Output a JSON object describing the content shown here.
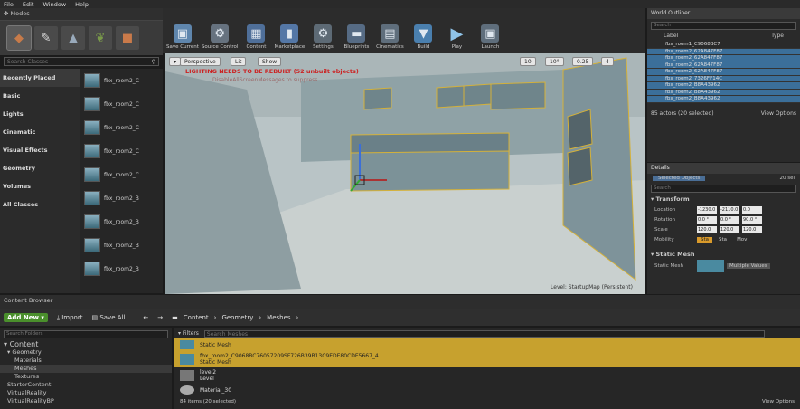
{
  "menu": [
    "File",
    "Edit",
    "Window",
    "Help"
  ],
  "modes": {
    "tab": "Modes",
    "search_placeholder": "Search Classes"
  },
  "categories": [
    "Recently Placed",
    "Basic",
    "Lights",
    "Cinematic",
    "Visual Effects",
    "Geometry",
    "Volumes",
    "All Classes"
  ],
  "placed_items": [
    "fbx_room2_C",
    "fbx_room2_C",
    "fbx_room2_C",
    "fbx_room2_C",
    "fbx_room2_C",
    "fbx_room2_B",
    "fbx_room2_B",
    "fbx_room2_B",
    "fbx_room2_B"
  ],
  "toolbar": [
    {
      "label": "Save Current",
      "icon": "save-icon",
      "color": "#6a8fb5"
    },
    {
      "label": "Source Control",
      "icon": "source-control-icon",
      "color": "#6d7c8a"
    },
    {
      "label": "Content",
      "icon": "content-icon",
      "color": "#5877a0"
    },
    {
      "label": "Marketplace",
      "icon": "marketplace-icon",
      "color": "#5b7fb0"
    },
    {
      "label": "Settings",
      "icon": "gear-icon",
      "color": "#6b7a86"
    },
    {
      "label": "Blueprints",
      "icon": "blueprint-icon",
      "color": "#5d7592"
    },
    {
      "label": "Cinematics",
      "icon": "clapper-icon",
      "color": "#6a7a8a"
    },
    {
      "label": "Build",
      "icon": "build-icon",
      "color": "#4f86b8"
    },
    {
      "label": "Play",
      "icon": "play-icon",
      "color": "#4f86b8"
    },
    {
      "label": "Launch",
      "icon": "launch-icon",
      "color": "#6a7a8a"
    }
  ],
  "viewport": {
    "perspective": "Perspective",
    "lit": "Lit",
    "show": "Show",
    "warning": "LIGHTING NEEDS TO BE REBUILT (52 unbuilt objects)",
    "warning_sub": "DisableAllScreenMessages to suppress",
    "level": "Level:",
    "level_name": "StartupMap (Persistent)",
    "snap": [
      "10",
      "10°",
      "0.25",
      "4"
    ]
  },
  "outliner": {
    "tab": "World Outliner",
    "search_placeholder": "Search",
    "col_label": "Label",
    "col_type": "Type",
    "rows": [
      "fbx_room1_C9068BC7",
      "fbx_room2_62A847F87",
      "fbx_room2_62A847F87",
      "fbx_room2_62A847F87",
      "fbx_room2_62A847F87",
      "fbx_room2_7326FF14C",
      "fbx_room2_B8A43962",
      "fbx_room2_B8A43962",
      "fbx_room2_B8A43962"
    ],
    "row_type": "StaticMeshActor",
    "footer": "85 actors (20 selected)",
    "view_options": "View Options"
  },
  "details": {
    "tab": "Details",
    "selected": "Selected Objects",
    "count": "20 sel",
    "search_placeholder": "Search",
    "transform": "Transform",
    "location": "Location",
    "rotation": "Rotation",
    "scale": "Scale",
    "mobility": "Mobility",
    "loc": [
      "-1230.0",
      "-2110.0",
      "0.0"
    ],
    "rot": [
      "0.0 °",
      "0.0 °",
      "90.0 °"
    ],
    "scl": [
      "120.0",
      "120.0",
      "120.0"
    ],
    "mob": [
      "Sta",
      "Sta",
      "Mov"
    ],
    "static_mesh": "Static Mesh",
    "static_mesh_label": "Static Mesh",
    "multiple": "Multiple Values"
  },
  "content_browser": {
    "tab": "Content Browser",
    "add_new": "Add New",
    "import": "Import",
    "save_all": "Save All",
    "breadcrumb": [
      "Content",
      "Geometry",
      "Meshes"
    ],
    "folder_search": "Search Folders",
    "filters": "Filters",
    "asset_search": "Search Meshes"
  },
  "folders": [
    "Content",
    "Geometry",
    "Materials",
    "Meshes",
    "Textures",
    "StarterContent",
    "VirtualReality",
    "VirtualRealityBP"
  ],
  "assets": [
    {
      "name": "Static Mesh",
      "sub": "",
      "sel": true
    },
    {
      "name": "fbx_room2_C9068BC76057209SF726B39B13C9EDE80CDE5667_4",
      "sub": "Static Mesh",
      "sel": true
    },
    {
      "name": "level2",
      "sub": "Level",
      "sel": false
    },
    {
      "name": "Material_30",
      "sub": "",
      "sel": false
    }
  ],
  "asset_footer": "84 items (20 selected)",
  "view_options": "View Options"
}
